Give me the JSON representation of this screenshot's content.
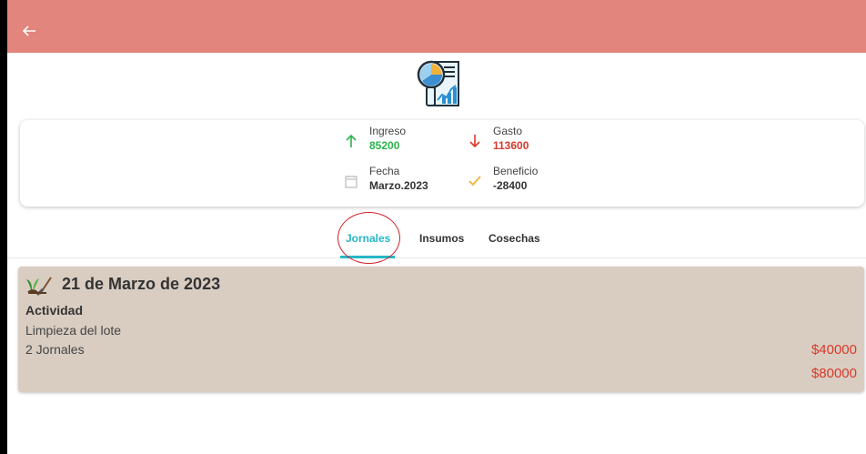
{
  "appbar": {
    "back_icon": "arrow-left-icon",
    "color": "#e2857d"
  },
  "logo_icon": "report-magnifier-icon",
  "summary": {
    "income": {
      "label": "Ingreso",
      "value": "85200",
      "icon": "arrow-up-icon"
    },
    "expense": {
      "label": "Gasto",
      "value": "113600",
      "icon": "arrow-down-icon"
    },
    "date": {
      "label": "Fecha",
      "value": "Marzo.2023",
      "icon": "calendar-icon"
    },
    "profit": {
      "label": "Beneficio",
      "value": "-28400",
      "icon": "check-icon"
    }
  },
  "tabs": [
    {
      "label": "Jornales",
      "active": true
    },
    {
      "label": "Insumos",
      "active": false
    },
    {
      "label": "Cosechas",
      "active": false
    }
  ],
  "entry": {
    "date": "21 de Marzo de 2023",
    "heading": "Actividad",
    "description": "Limpieza del lote",
    "count": "2 Jornales",
    "unit_price": "$40000",
    "total": "$80000"
  },
  "colors": {
    "accent": "#25b7c8",
    "income": "#2bb44c",
    "expense": "#d8392b",
    "entry_bg": "#d9cdc2"
  }
}
